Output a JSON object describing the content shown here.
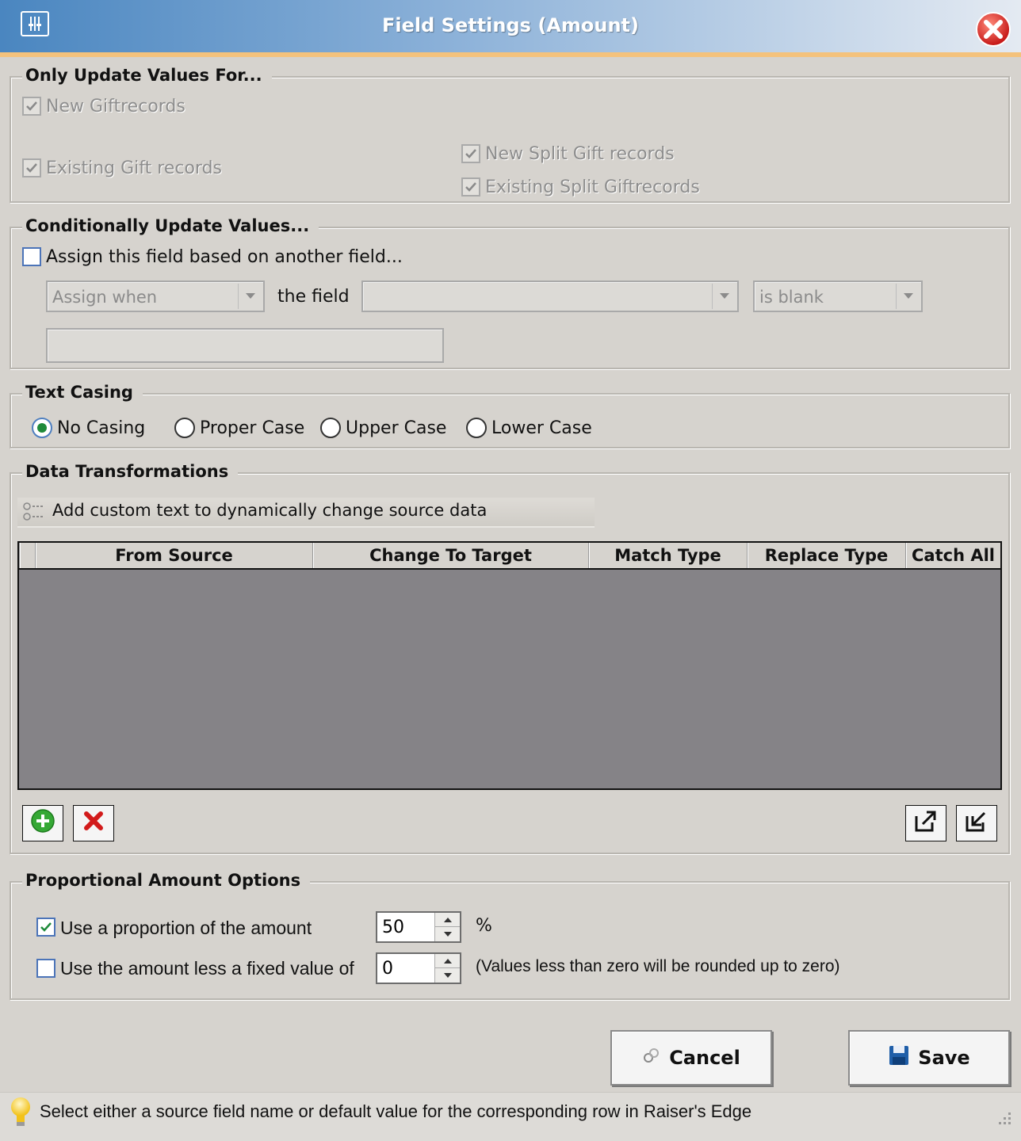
{
  "window": {
    "title": "Field Settings (Amount)"
  },
  "update_for": {
    "legend": "Only Update Values For...",
    "new_gift": "New Giftrecords",
    "existing_gift": "Existing Gift records",
    "new_split": "New Split Gift records",
    "existing_split": "Existing Split Giftrecords"
  },
  "conditional": {
    "legend": "Conditionally Update Values...",
    "assign_label": "Assign this field based on another field...",
    "assign_when": "Assign when",
    "the_field": "the field",
    "field_value": "",
    "condition": "is blank",
    "value_input": ""
  },
  "casing": {
    "legend": "Text Casing",
    "options": [
      "No Casing",
      "Proper Case",
      "Upper Case",
      "Lower Case"
    ],
    "selected": "No Casing"
  },
  "transform": {
    "legend": "Data Transformations",
    "hint": "Add custom text to dynamically change source data",
    "columns": [
      "From Source",
      "Change To Target",
      "Match Type",
      "Replace Type",
      "Catch All"
    ],
    "rows": []
  },
  "proportional": {
    "legend": "Proportional Amount Options",
    "use_proportion_label": "Use a proportion of the amount",
    "use_proportion_value": "50",
    "percent": "%",
    "fixed_label": "Use the amount less a fixed value of",
    "fixed_value": "0",
    "fixed_note": "(Values less than zero will be rounded up to zero)"
  },
  "buttons": {
    "cancel": "Cancel",
    "save": "Save"
  },
  "status": {
    "message": "Select either a source field name or default value for the corresponding row in Raiser's Edge"
  },
  "colors": {
    "title_start": "#4a86c0",
    "accent_orange": "#f4c27c",
    "grid_bg": "#858387",
    "save_icon": "#1f5ea8"
  }
}
